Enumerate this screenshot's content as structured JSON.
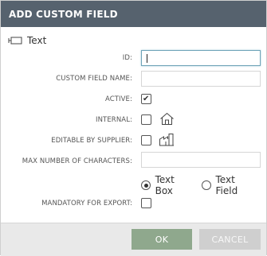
{
  "dialog": {
    "title": "ADD CUSTOM FIELD",
    "field_type_label": "Text",
    "fields": {
      "id_label": "ID:",
      "name_label": "CUSTOM FIELD NAME:",
      "active_label": "ACTIVE:",
      "internal_label": "INTERNAL:",
      "editable_label": "EDITABLE BY SUPPLIER:",
      "max_chars_label": "MAX NUMBER OF CHARACTERS:",
      "mandatory_label": "MANDATORY FOR EXPORT:"
    },
    "values": {
      "id": "",
      "name": "",
      "max_chars": "",
      "active": true,
      "internal": false,
      "editable_by_supplier": false,
      "mandatory_for_export": false
    },
    "text_format": {
      "options": [
        "Text Box",
        "Text Field"
      ],
      "selected": "Text Box"
    },
    "buttons": {
      "ok": "OK",
      "cancel": "CANCEL"
    },
    "icons": {
      "field_type": "text-field-icon",
      "internal": "house-icon",
      "editable": "factory-icon"
    },
    "colors": {
      "titlebar": "#56626e",
      "ok_button": "#8fa88d",
      "cancel_button": "#cfcfcf",
      "footer": "#e9e9e9"
    }
  }
}
